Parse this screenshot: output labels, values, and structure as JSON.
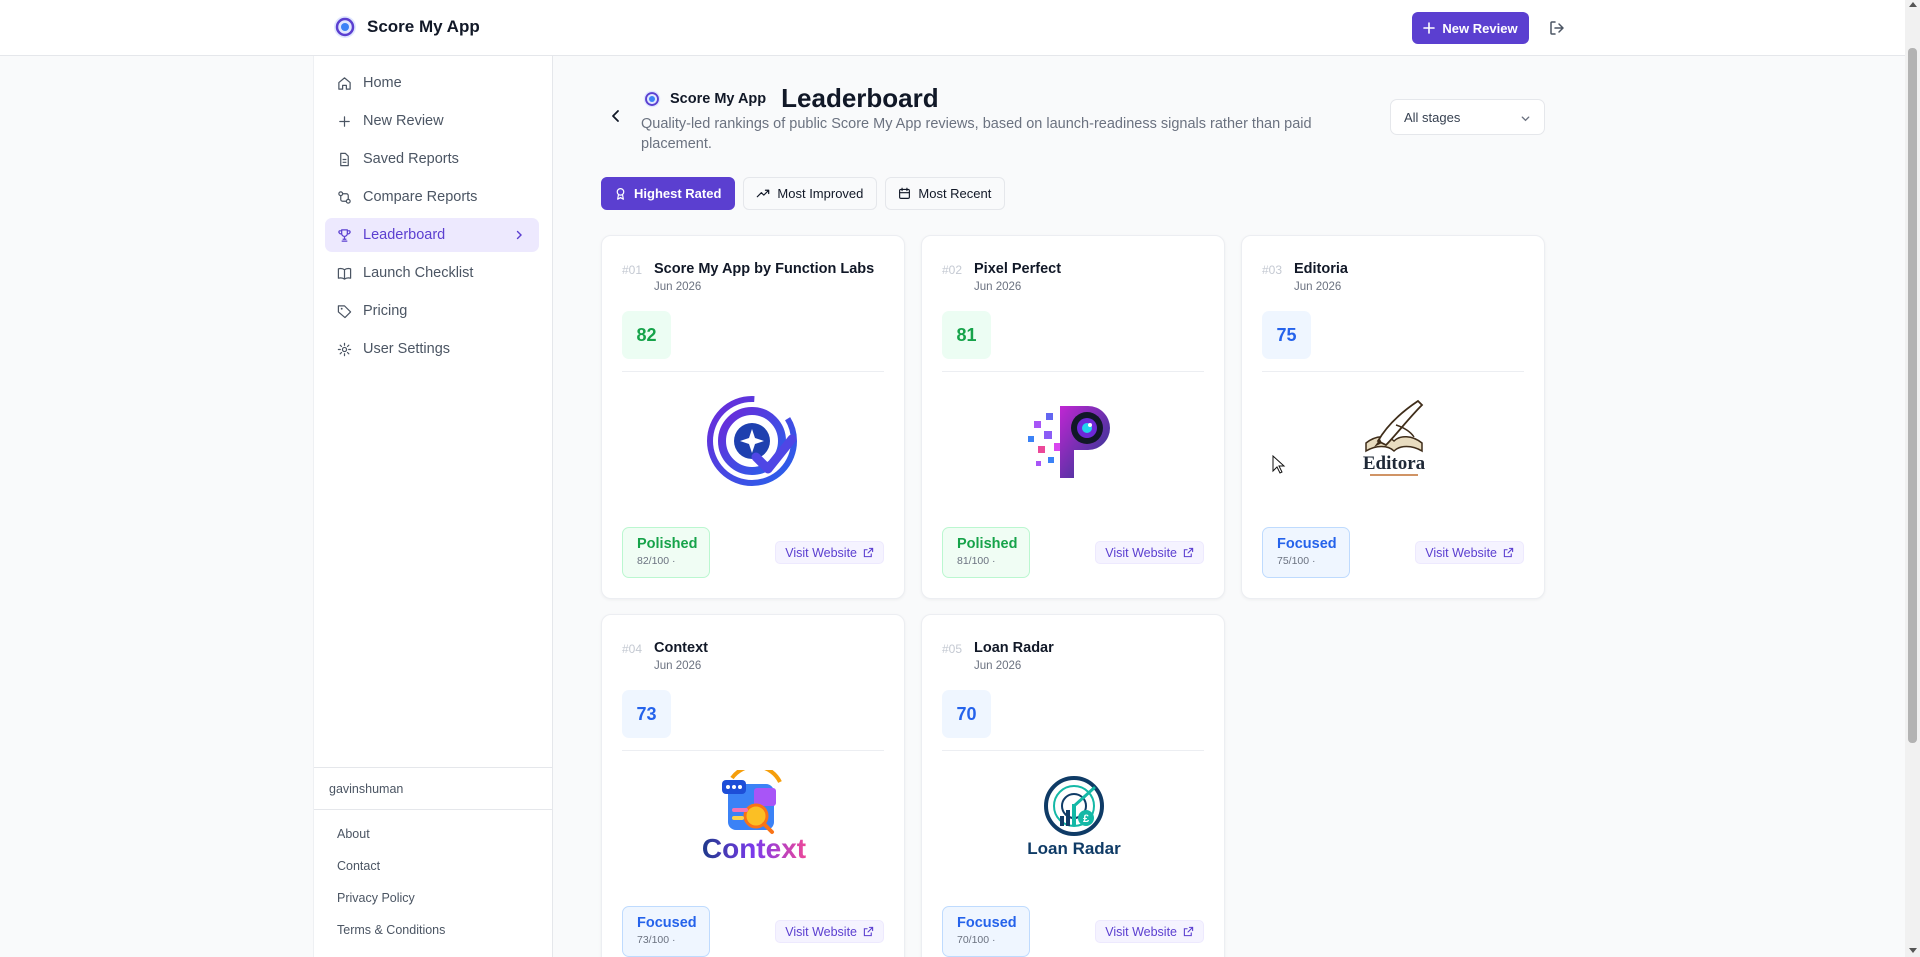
{
  "app": {
    "name": "Score My App"
  },
  "topbar": {
    "new_review_label": "New Review"
  },
  "sidebar": {
    "items": [
      {
        "label": "Home",
        "icon": "home-icon"
      },
      {
        "label": "New Review",
        "icon": "plus-icon"
      },
      {
        "label": "Saved Reports",
        "icon": "file-icon"
      },
      {
        "label": "Compare Reports",
        "icon": "compare-icon"
      },
      {
        "label": "Leaderboard",
        "icon": "trophy-icon",
        "active": true
      },
      {
        "label": "Launch Checklist",
        "icon": "book-icon"
      },
      {
        "label": "Pricing",
        "icon": "tag-icon"
      },
      {
        "label": "User Settings",
        "icon": "gear-icon"
      }
    ],
    "username": "gavinshuman",
    "footer_links": [
      "About",
      "Contact",
      "Privacy Policy",
      "Terms & Conditions"
    ]
  },
  "header": {
    "brand": "Score My App",
    "title": "Leaderboard",
    "description": "Quality-led rankings of public Score My App reviews, based on launch-readiness signals rather than paid placement.",
    "stage_filter": "All stages"
  },
  "tabs": [
    {
      "label": "Highest Rated",
      "icon": "award-icon",
      "active": true
    },
    {
      "label": "Most Improved",
      "icon": "trending-up-icon"
    },
    {
      "label": "Most Recent",
      "icon": "calendar-icon"
    }
  ],
  "cards": [
    {
      "rank": "#01",
      "name": "Score My App by Function Labs",
      "date": "Jun 2026",
      "score": "82",
      "badge": "Polished",
      "badge_sub": "82/100 ·",
      "visit": "Visit Website"
    },
    {
      "rank": "#02",
      "name": "Pixel Perfect",
      "date": "Jun 2026",
      "score": "81",
      "badge": "Polished",
      "badge_sub": "81/100 ·",
      "visit": "Visit Website"
    },
    {
      "rank": "#03",
      "name": "Editoria",
      "date": "Jun 2026",
      "score": "75",
      "badge": "Focused",
      "badge_sub": "75/100 ·",
      "visit": "Visit Website",
      "logo_text": "Editora"
    },
    {
      "rank": "#04",
      "name": "Context",
      "date": "Jun 2026",
      "score": "73",
      "badge": "Focused",
      "badge_sub": "73/100 ·",
      "visit": "Visit Website",
      "logo_text": "Context"
    },
    {
      "rank": "#05",
      "name": "Loan Radar",
      "date": "Jun 2026",
      "score": "70",
      "badge": "Focused",
      "badge_sub": "70/100 ·",
      "visit": "Visit Website",
      "logo_text": "Loan Radar"
    }
  ],
  "colors": {
    "accent": "#5b3fd0",
    "polished": "#16a34a",
    "focused": "#2563eb"
  }
}
